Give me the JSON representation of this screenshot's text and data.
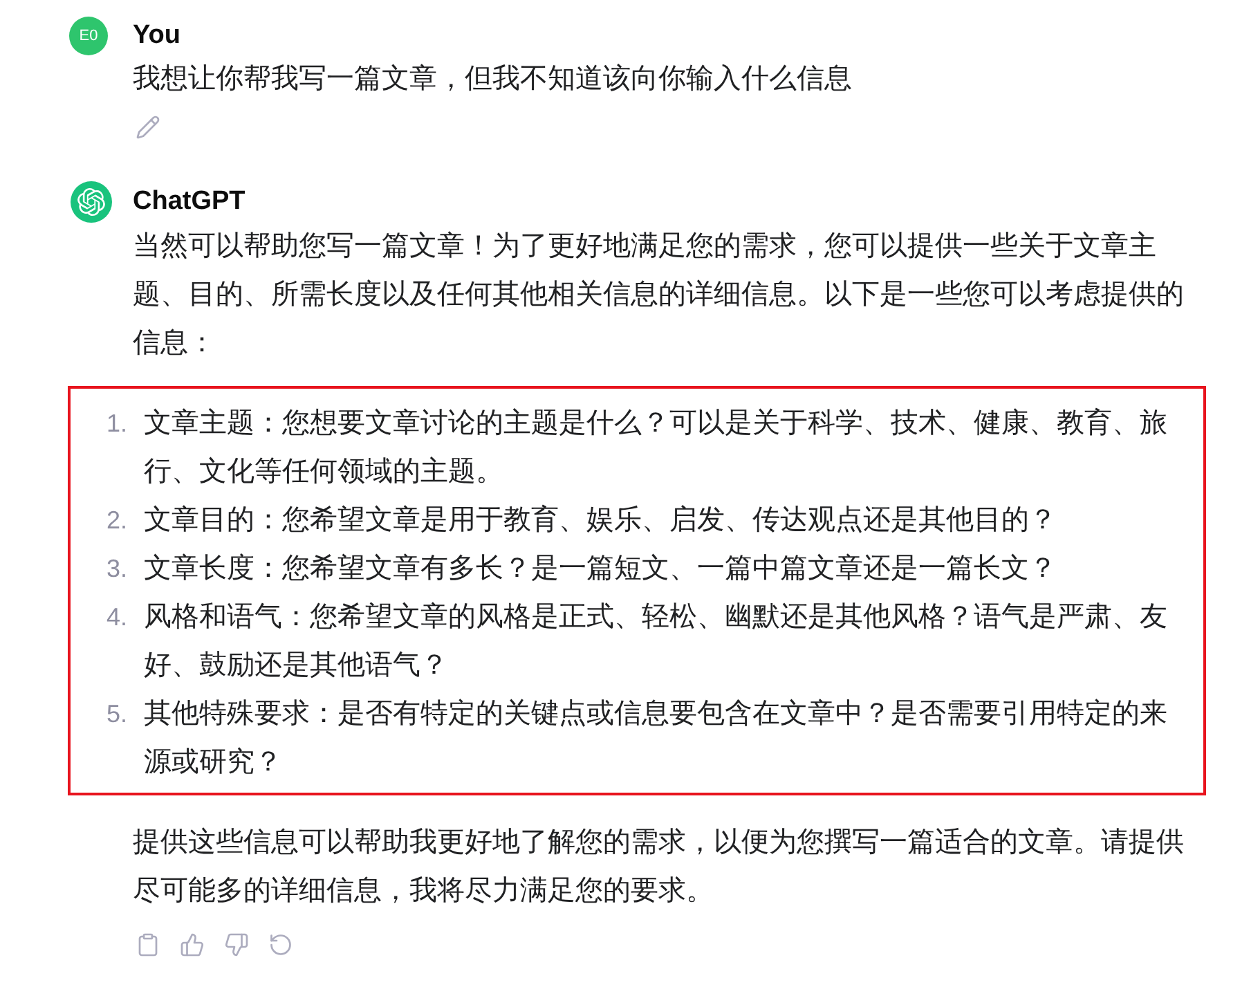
{
  "user_message": {
    "avatar": "E0",
    "author": "You",
    "text": "我想让你帮我写一篇文章，但我不知道该向你输入什么信息"
  },
  "assistant_message": {
    "author": "ChatGPT",
    "intro": "当然可以帮助您写一篇文章！为了更好地满足您的需求，您可以提供一些关于文章主题、目的、所需长度以及任何其他相关信息的详细信息。以下是一些您可以考虑提供的信息：",
    "list": {
      "highlighted": true,
      "items": [
        {
          "number": "1.",
          "text": "文章主题：您想要文章讨论的主题是什么？可以是关于科学、技术、健康、教育、旅行、文化等任何领域的主题。"
        },
        {
          "number": "2.",
          "text": "文章目的：您希望文章是用于教育、娱乐、启发、传达观点还是其他目的？"
        },
        {
          "number": "3.",
          "text": "文章长度：您希望文章有多长？是一篇短文、一篇中篇文章还是一篇长文？"
        },
        {
          "number": "4.",
          "text": "风格和语气：您希望文章的风格是正式、轻松、幽默还是其他风格？语气是严肃、友好、鼓励还是其他语气？"
        },
        {
          "number": "5.",
          "text": "其他特殊要求：是否有特定的关键点或信息要包含在文章中？是否需要引用特定的来源或研究？"
        }
      ]
    },
    "closing": "提供这些信息可以帮助我更好地了解您的需求，以便为您撰写一篇适合的文章。请提供尽可能多的详细信息，我将尽力满足您的要求。"
  }
}
